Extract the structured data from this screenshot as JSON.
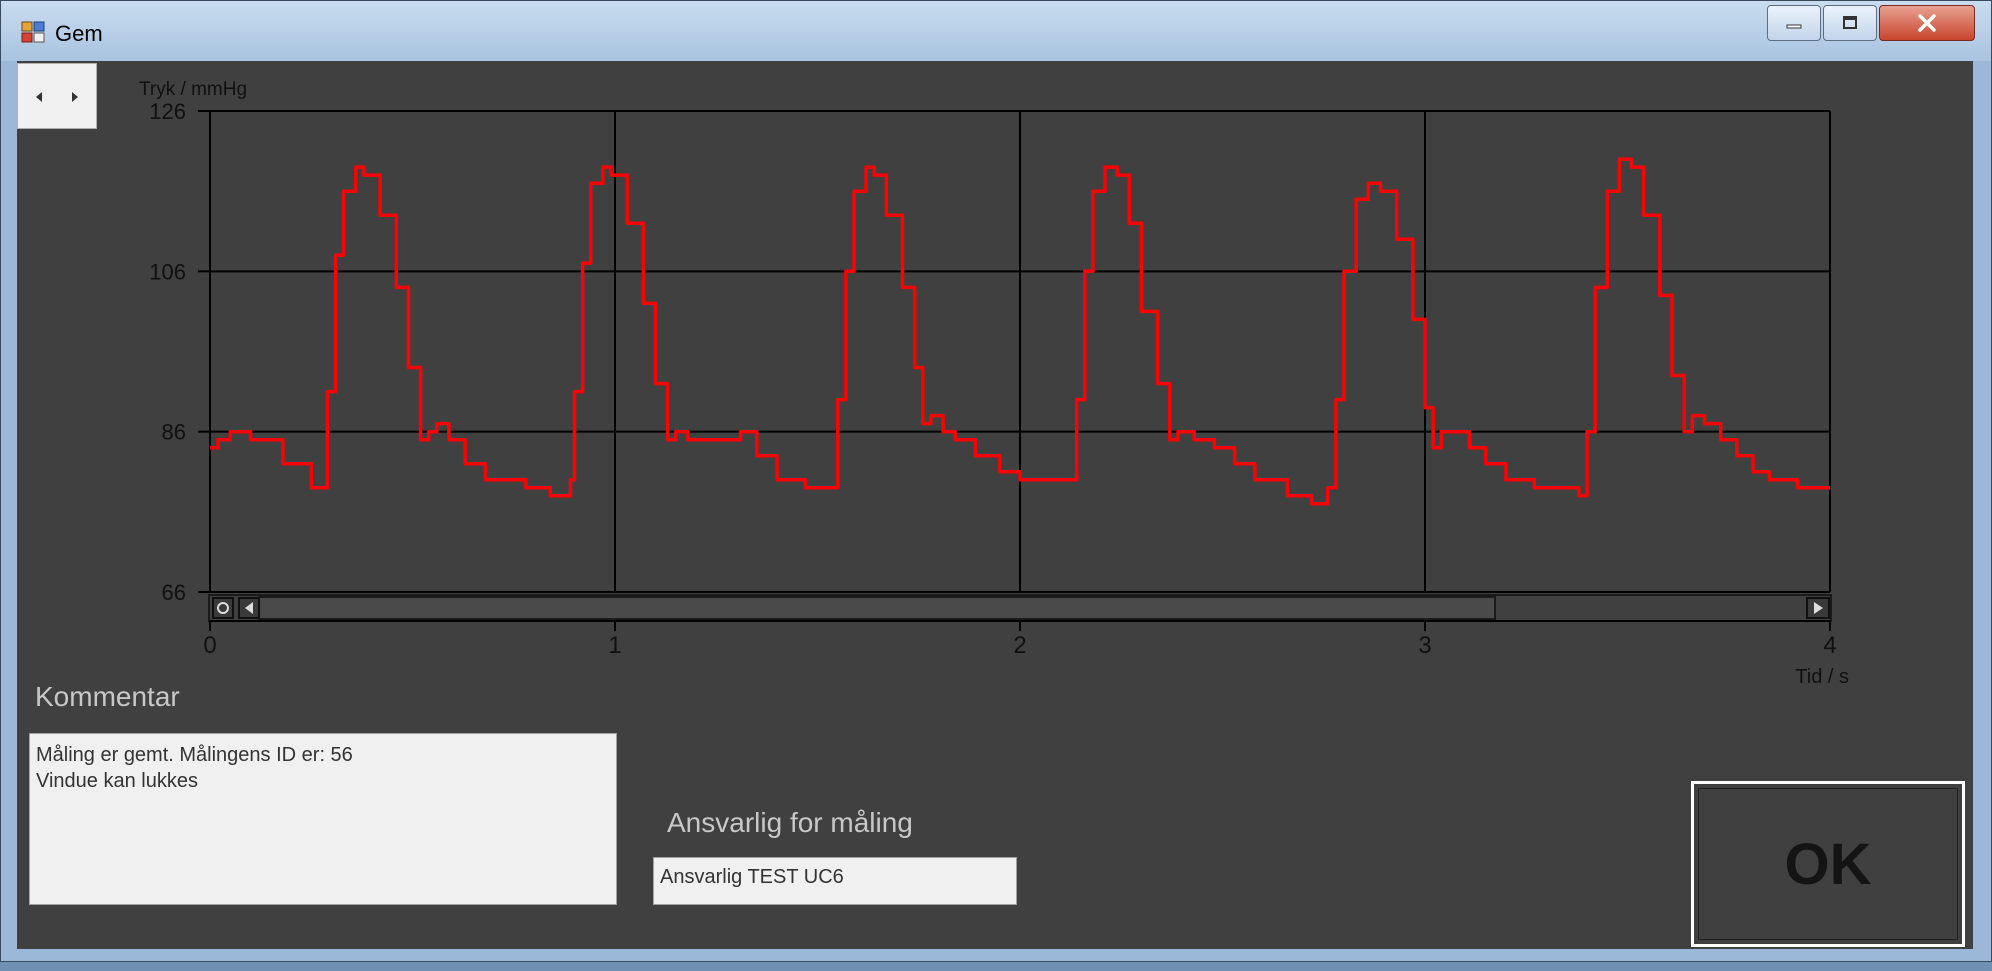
{
  "window": {
    "title": "Gem",
    "minimize_icon": "minimize-icon",
    "maximize_icon": "maximize-icon",
    "close_icon": "close-icon"
  },
  "nav": {
    "prev_icon": "triangle-left-icon",
    "next_icon": "triangle-right-icon"
  },
  "chart_data": {
    "type": "line",
    "title": "",
    "ylabel": "Tryk / mmHg",
    "xlabel": "Tid / s",
    "xlim": [
      0,
      4
    ],
    "ylim": [
      66,
      126
    ],
    "x_ticks": [
      "0",
      "1",
      "2",
      "3",
      "4"
    ],
    "y_ticks": [
      "66",
      "86",
      "106",
      "126"
    ],
    "grid": true,
    "line_color": "#ff0000",
    "series": [
      {
        "x": [
          0,
          0.02,
          0.05,
          0.1,
          0.18,
          0.25,
          0.28,
          0.29,
          0.31,
          0.33,
          0.36,
          0.38,
          0.42,
          0.46,
          0.49,
          0.52,
          0.54,
          0.56,
          0.59,
          0.63,
          0.68,
          0.72,
          0.78,
          0.84,
          0.89,
          0.9,
          0.92,
          0.94,
          0.97,
          0.99,
          1.03,
          1.07,
          1.1,
          1.13,
          1.15,
          1.18,
          1.2,
          1.25,
          1.31,
          1.35,
          1.4,
          1.47,
          1.53,
          1.55,
          1.57,
          1.59,
          1.62,
          1.64,
          1.67,
          1.71,
          1.74,
          1.76,
          1.78,
          1.81,
          1.84,
          1.89,
          1.95,
          2.0,
          2.06,
          2.12,
          2.14,
          2.16,
          2.18,
          2.21,
          2.24,
          2.27,
          2.3,
          2.34,
          2.37,
          2.39,
          2.43,
          2.48,
          2.53,
          2.58,
          2.66,
          2.72,
          2.76,
          2.78,
          2.8,
          2.83,
          2.86,
          2.89,
          2.93,
          2.97,
          3.0,
          3.02,
          3.04,
          3.07,
          3.11,
          3.15,
          3.2,
          3.27,
          3.34,
          3.38,
          3.4,
          3.42,
          3.45,
          3.48,
          3.51,
          3.54,
          3.58,
          3.61,
          3.64,
          3.66,
          3.69,
          3.73,
          3.77,
          3.81,
          3.85,
          3.92,
          4.0
        ],
        "y": [
          84,
          85,
          86,
          85,
          82,
          79,
          79,
          91,
          108,
          116,
          119,
          118,
          113,
          104,
          94,
          85,
          86,
          87,
          85,
          82,
          80,
          80,
          79,
          78,
          80,
          91,
          107,
          117,
          119,
          118,
          112,
          102,
          92,
          85,
          86,
          85,
          85,
          85,
          86,
          83,
          80,
          79,
          79,
          90,
          106,
          116,
          119,
          118,
          113,
          104,
          94,
          87,
          88,
          86,
          85,
          83,
          81,
          80,
          80,
          80,
          90,
          106,
          116,
          119,
          118,
          112,
          101,
          92,
          85,
          86,
          85,
          84,
          82,
          80,
          78,
          77,
          79,
          90,
          106,
          115,
          117,
          116,
          110,
          100,
          89,
          84,
          86,
          86,
          84,
          82,
          80,
          79,
          79,
          78,
          86,
          104,
          116,
          120,
          119,
          113,
          103,
          93,
          86,
          88,
          87,
          85,
          83,
          81,
          80,
          79,
          79
        ]
      }
    ]
  },
  "comment": {
    "label": "Kommentar",
    "lines": [
      "Måling er gemt. Målingens ID er: 56",
      "Vindue kan lukkes"
    ]
  },
  "responsible": {
    "label": "Ansvarlig for måling",
    "value": "Ansvarlig TEST UC6"
  },
  "ok_button": {
    "label": "OK"
  }
}
